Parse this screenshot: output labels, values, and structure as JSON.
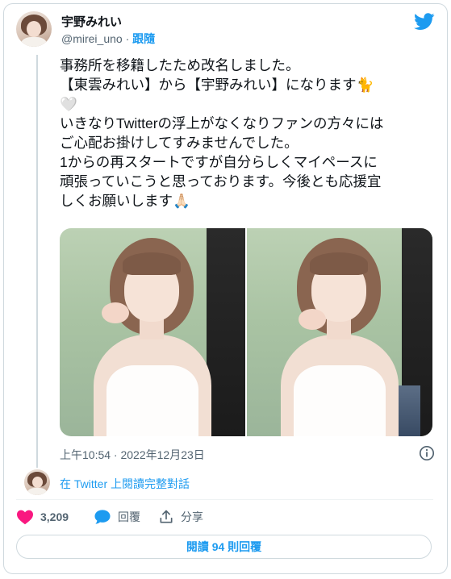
{
  "user": {
    "display_name": "宇野みれい",
    "handle": "@mirei_uno",
    "separator": "·",
    "follow_label": "跟隨"
  },
  "tweet": {
    "text": "事務所を移籍したため改名しました。\n【東雲みれい】から【宇野みれい】になります🐈\n🤍\nいきなりTwitterの浮上がなくなりファンの方々には\nご心配お掛けしてすみませんでした。\n1からの再スタートですが自分らしくマイペースに\n頑張っていこうと思っております。今後とも応援宜\nしくお願いします🙏🏻",
    "timestamp": "上午10:54 · 2022年12月23日",
    "photo_count": 2
  },
  "conversation": {
    "label": "在 Twitter 上閱讀完整對話"
  },
  "actions": {
    "like_count": "3,209",
    "reply_label": "回覆",
    "share_label": "分享"
  },
  "footer": {
    "read_replies_label": "閱讀 94 則回覆"
  },
  "colors": {
    "brand": "#1d9bf0",
    "like": "#f91880",
    "text": "#0f1419",
    "muted": "#536471",
    "border": "#cfd9de"
  },
  "icons": {
    "logo": "twitter-bird-icon",
    "info": "info-icon",
    "like": "heart-icon",
    "reply": "chat-bubble-icon",
    "share": "share-upload-icon"
  }
}
